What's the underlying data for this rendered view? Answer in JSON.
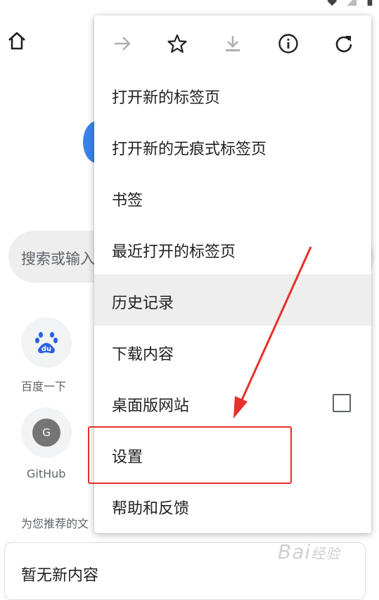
{
  "background_page": {
    "search_placeholder": "搜索或输入",
    "tiles": [
      {
        "label": "百度一下",
        "icon": "baidu-icon"
      },
      {
        "label": "GitHub",
        "icon": "letter-g-icon",
        "letter": "G"
      }
    ],
    "recommend_label": "为您推荐的文",
    "card_title": "暂无新内容"
  },
  "menu": {
    "icons": [
      "forward-arrow-icon",
      "star-icon",
      "download-icon",
      "info-icon",
      "refresh-icon"
    ],
    "items": [
      {
        "label": "打开新的标签页"
      },
      {
        "label": "打开新的无痕式标签页"
      },
      {
        "label": "书签"
      },
      {
        "label": "最近打开的标签页"
      },
      {
        "label": "历史记录",
        "highlighted": true
      },
      {
        "label": "下载内容"
      },
      {
        "label": "桌面版网站",
        "checkbox": false
      },
      {
        "label": "设置"
      },
      {
        "label": "帮助和反馈"
      }
    ]
  },
  "annotation": {
    "highlight_color": "#e8302a",
    "target": "设置"
  },
  "watermark": "Bai经验"
}
